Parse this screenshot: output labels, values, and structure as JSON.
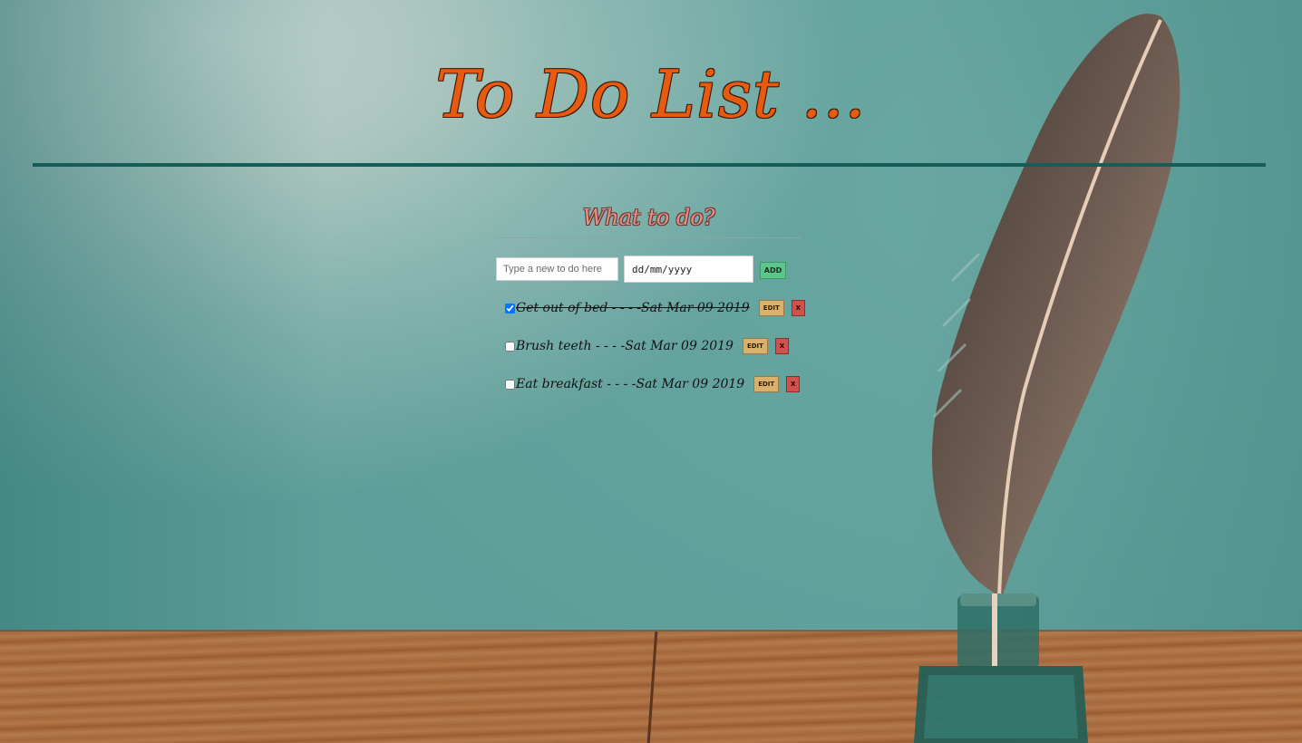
{
  "header": {
    "title": "To Do List ..."
  },
  "form": {
    "heading": "What to do?",
    "task_placeholder": "Type a new to do here",
    "date_placeholder": "dd/mm/yyyy",
    "add_label": "ADD"
  },
  "todos": [
    {
      "text": "Get out of bed - - - -Sat Mar 09 2019",
      "done": true,
      "edit_label": "EDIT",
      "delete_label": "X"
    },
    {
      "text": "Brush teeth - - - -Sat Mar 09 2019",
      "done": false,
      "edit_label": "EDIT",
      "delete_label": "X"
    },
    {
      "text": "Eat breakfast - - - -Sat Mar 09 2019",
      "done": false,
      "edit_label": "EDIT",
      "delete_label": "X"
    }
  ],
  "colors": {
    "title": "#e85a10",
    "rule": "#155e57",
    "subtitle": "#e38f86",
    "add_button": "#5cc58b",
    "edit_button": "#d9b06c",
    "delete_button": "#d0524f"
  }
}
